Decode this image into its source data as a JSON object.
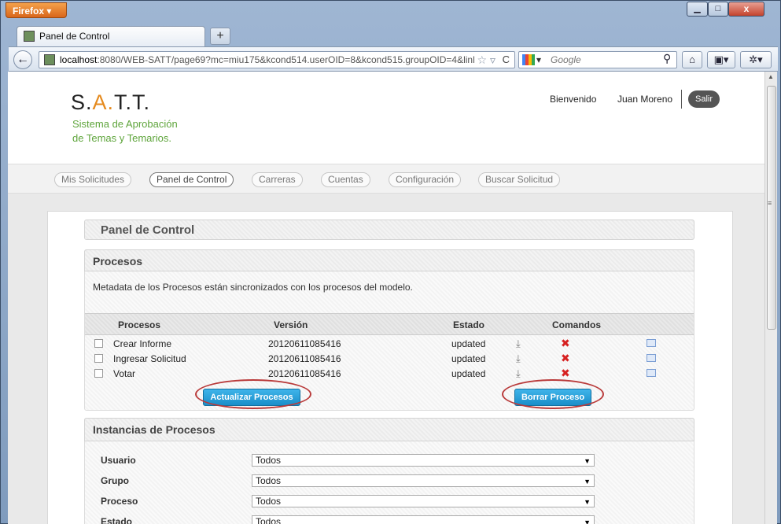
{
  "browser": {
    "app_button": "Firefox",
    "tab_title": "Panel de Control",
    "url_host": "localhost",
    "url_rest": ":8080/WEB-SATT/page69?mc=miu175&kcond514.userOID=8&kcond515.groupOID=4&linl",
    "search_placeholder": "Google",
    "close_glyph": "x"
  },
  "header": {
    "logo_s": "S.",
    "logo_a": "A.",
    "logo_tt": "T.T.",
    "subtitle_line1": "Sistema de Aprobación",
    "subtitle_line2": "de Temas y Temarios.",
    "welcome": "Bienvenido",
    "user": "Juan Moreno",
    "logout": "Salir"
  },
  "nav": {
    "items": [
      "Mis Solicitudes",
      "Panel de Control",
      "Carreras",
      "Cuentas",
      "Configuración",
      "Buscar Solicitud"
    ],
    "active": "Panel de Control"
  },
  "page_title": "Panel de Control",
  "procesos": {
    "title": "Procesos",
    "note": "Metadata de los Procesos están sincronizados con los procesos del modelo.",
    "columns": [
      "Procesos",
      "Versión",
      "Estado",
      "Comandos"
    ],
    "rows": [
      {
        "name": "Crear Informe",
        "version": "20120611085416",
        "state": "updated"
      },
      {
        "name": "Ingresar Solicitud",
        "version": "20120611085416",
        "state": "updated"
      },
      {
        "name": "Votar",
        "version": "20120611085416",
        "state": "updated"
      }
    ],
    "update_button": "Actualizar Procesos",
    "delete_button": "Borrar Proceso"
  },
  "instancias": {
    "title": "Instancias de Procesos",
    "filters": [
      {
        "label": "Usuario",
        "value": "Todos"
      },
      {
        "label": "Grupo",
        "value": "Todos"
      },
      {
        "label": "Proceso",
        "value": "Todos"
      },
      {
        "label": "Estado",
        "value": "Todos"
      }
    ]
  },
  "colors": {
    "accent_orange": "#e58a1e",
    "subtitle_green": "#5fa53c",
    "button_blue": "#1a8ec9",
    "annotation_red": "#b93a3a",
    "delete_red": "#d62020"
  }
}
